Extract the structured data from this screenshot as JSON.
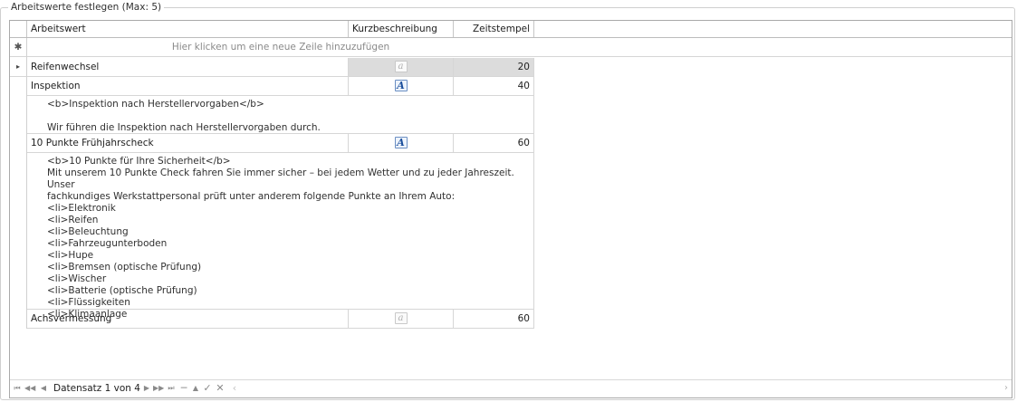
{
  "group": {
    "title": "Arbeitswerte festlegen (Max: 5)"
  },
  "columns": {
    "arbeitswert": "Arbeitswert",
    "kurz": "Kurzbeschreibung",
    "zeit": "Zeitstempel"
  },
  "new_row": {
    "hint": "Hier klicken um eine neue Zeile hinzuzufügen",
    "indicator": "✱"
  },
  "rows": [
    {
      "arbeitswert": "Reifenwechsel",
      "zeit": "20",
      "has_description": false,
      "indicator": "▸"
    },
    {
      "arbeitswert": "Inspektion",
      "zeit": "40",
      "has_description": true,
      "preview": "<b>Inspektion nach Herstellervorgaben</b>\n\nWir führen die Inspektion nach Herstellervorgaben durch."
    },
    {
      "arbeitswert": "10 Punkte Frühjahrscheck",
      "zeit": "60",
      "has_description": true,
      "preview": "<b>10 Punkte für Ihre Sicherheit</b>\nMit unserem 10 Punkte Check fahren Sie immer sicher – bei jedem Wetter und zu jeder Jahreszeit. Unser\nfachkundiges Werkstattpersonal prüft unter anderem folgende Punkte an Ihrem Auto:\n<li>Elektronik\n<li>Reifen\n<li>Beleuchtung\n<li>Fahrzeugunterboden\n<li>Hupe\n<li>Bremsen (optische Prüfung)\n<li>Wischer\n<li>Batterie (optische Prüfung)\n<li>Flüssigkeiten\n<li>Klimaanlage"
    },
    {
      "arbeitswert": "Achsvermessung",
      "zeit": "60",
      "has_description": false
    }
  ],
  "icons": {
    "description_off": "a",
    "description_on": "A"
  },
  "navigator": {
    "record_text": "Datensatz 1 von 4",
    "buttons": [
      "first-icon",
      "prev-page-icon",
      "prev-icon",
      "next-icon",
      "next-page-icon",
      "last-icon",
      "append-icon",
      "delete-icon",
      "edit-icon",
      "end-edit-icon",
      "cancel-edit-icon"
    ]
  }
}
